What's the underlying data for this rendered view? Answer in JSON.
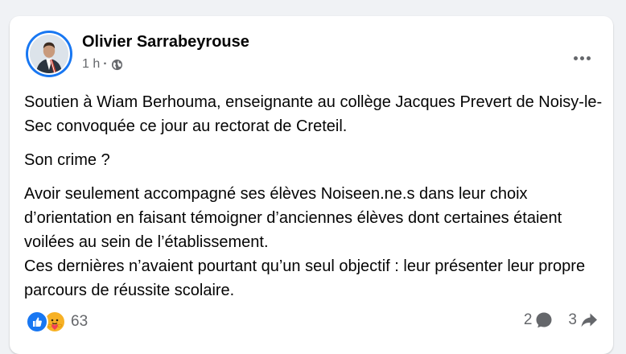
{
  "post": {
    "author": "Olivier Sarrabeyrouse",
    "time": "1 h",
    "separator": "·",
    "audience_icon": "globe-icon",
    "paragraphs": [
      "Soutien à Wiam Berhouma, enseignante au collège Jacques Prevert de Noisy-le-Sec convoquée ce jour au rectorat de Creteil.",
      "Son crime ?",
      "Avoir seulement accompagné ses élèves Noiseen.ne.s dans leur choix d’orientation en faisant témoigner d’anciennes élèves dont certaines étaient voilées au sein de l’établissement.",
      "Ces dernières n’avaient pourtant qu’un seul objectif : leur présenter leur propre parcours de réussite scolaire."
    ]
  },
  "footer": {
    "reaction_icons": [
      "like-icon",
      "care-icon"
    ],
    "reaction_count": "63",
    "comment_count": "2",
    "share_count": "3"
  },
  "colors": {
    "accent": "#1877f2",
    "secondary_text": "#65676b",
    "care": "#f7b125"
  }
}
